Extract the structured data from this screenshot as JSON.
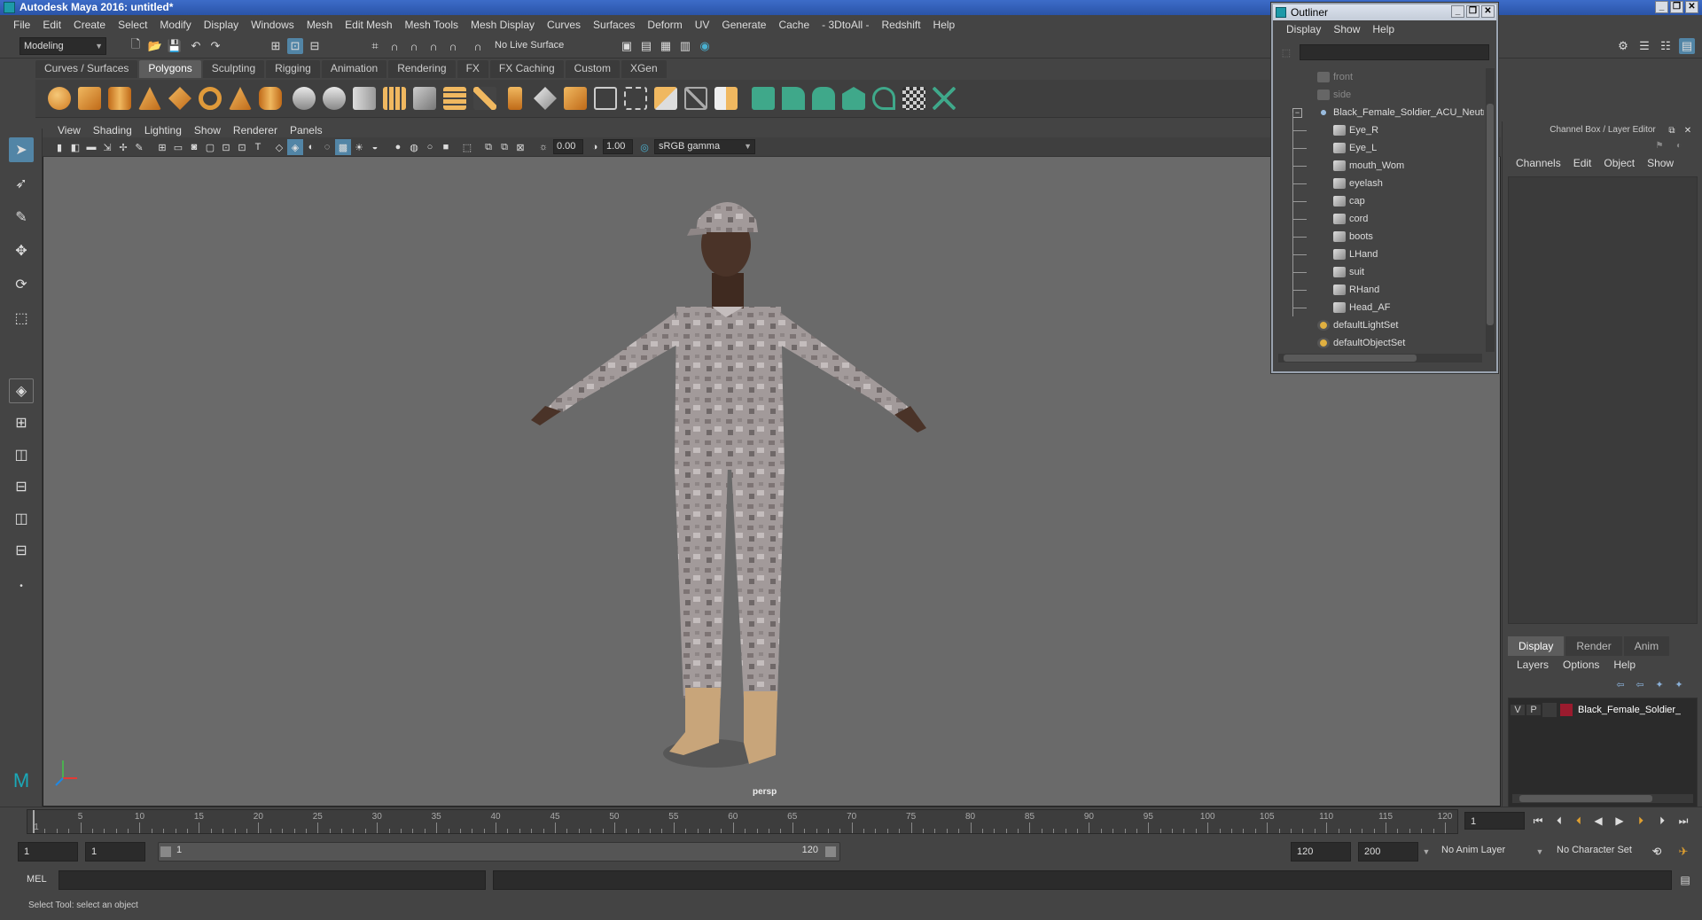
{
  "window": {
    "title": "Autodesk Maya 2016: untitled*",
    "app_icon": "maya-icon",
    "controls": [
      "_",
      "❐",
      "✕"
    ]
  },
  "menubar": [
    "File",
    "Edit",
    "Create",
    "Select",
    "Modify",
    "Display",
    "Windows",
    "Mesh",
    "Edit Mesh",
    "Mesh Tools",
    "Mesh Display",
    "Curves",
    "Surfaces",
    "Deform",
    "UV",
    "Generate",
    "Cache",
    "- 3DtoAll -",
    "Redshift",
    "Help"
  ],
  "statusline": {
    "mode": "Modeling",
    "live_surface": "No Live Surface"
  },
  "shelf": {
    "tabs": [
      "Curves / Surfaces",
      "Polygons",
      "Sculpting",
      "Rigging",
      "Animation",
      "Rendering",
      "FX",
      "FX Caching",
      "Custom",
      "XGen"
    ],
    "active_tab": "Polygons"
  },
  "panel_menu": [
    "View",
    "Shading",
    "Lighting",
    "Show",
    "Renderer",
    "Panels"
  ],
  "viewport_toolbar": {
    "exposure": "0.00",
    "gamma": "1.00",
    "color_space": "sRGB gamma"
  },
  "viewport": {
    "camera_label": "persp"
  },
  "outliner": {
    "title": "Outliner",
    "menu": [
      "Display",
      "Show",
      "Help"
    ],
    "items": [
      {
        "label": "front",
        "depth": 0,
        "icon": "camera-icon",
        "dim": true
      },
      {
        "label": "side",
        "depth": 0,
        "icon": "camera-icon",
        "dim": true
      },
      {
        "label": "Black_Female_Soldier_ACU_Neutr",
        "depth": 0,
        "icon": "group-icon",
        "expander": "−"
      },
      {
        "label": "Eye_R",
        "depth": 1,
        "icon": "mesh-icon"
      },
      {
        "label": "Eye_L",
        "depth": 1,
        "icon": "mesh-icon"
      },
      {
        "label": "mouth_Wom",
        "depth": 1,
        "icon": "mesh-icon"
      },
      {
        "label": "eyelash",
        "depth": 1,
        "icon": "mesh-icon"
      },
      {
        "label": "cap",
        "depth": 1,
        "icon": "mesh-icon"
      },
      {
        "label": "cord",
        "depth": 1,
        "icon": "mesh-icon"
      },
      {
        "label": "boots",
        "depth": 1,
        "icon": "mesh-icon"
      },
      {
        "label": "LHand",
        "depth": 1,
        "icon": "mesh-icon"
      },
      {
        "label": "suit",
        "depth": 1,
        "icon": "mesh-icon"
      },
      {
        "label": "RHand",
        "depth": 1,
        "icon": "mesh-icon"
      },
      {
        "label": "Head_AF",
        "depth": 1,
        "icon": "mesh-icon"
      },
      {
        "label": "defaultLightSet",
        "depth": 0,
        "icon": "set-icon"
      },
      {
        "label": "defaultObjectSet",
        "depth": 0,
        "icon": "set-icon"
      }
    ]
  },
  "channel_box": {
    "header": "Channel Box / Layer Editor",
    "menu": [
      "Channels",
      "Edit",
      "Object",
      "Show"
    ],
    "layer_tabs": [
      "Display",
      "Render",
      "Anim"
    ],
    "active_layer_tab": "Display",
    "layer_menu": [
      "Layers",
      "Options",
      "Help"
    ],
    "layer": {
      "v": "V",
      "p": "P",
      "name": "Black_Female_Soldier_",
      "color": "#9b1b2e"
    }
  },
  "timeline": {
    "ticks": [
      "1",
      "5",
      "10",
      "15",
      "20",
      "25",
      "30",
      "35",
      "40",
      "45",
      "50",
      "55",
      "60",
      "65",
      "70",
      "75",
      "80",
      "85",
      "90",
      "95",
      "100",
      "105",
      "110",
      "115",
      "120"
    ],
    "current_frame": "1"
  },
  "range": {
    "start": "1",
    "start_inner": "1",
    "slider_start": "1",
    "slider_end": "120",
    "end_inner": "120",
    "end": "200",
    "anim_layer": "No Anim Layer",
    "character_set": "No Character Set"
  },
  "command_line": {
    "lang": "MEL"
  },
  "help_line": "Select Tool: select an object",
  "colors": {
    "accent": "#5285a6",
    "shelf_green": "#3fa88a",
    "boots": "#c8a57a"
  }
}
